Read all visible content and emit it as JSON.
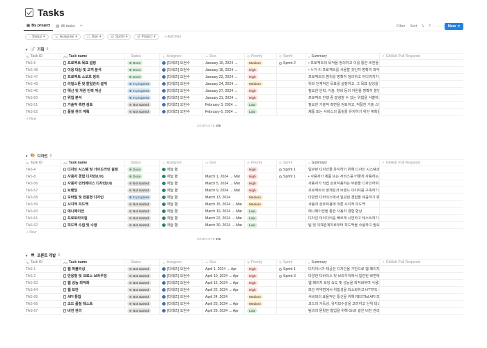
{
  "page": {
    "title": "Tasks"
  },
  "views": [
    {
      "label": "By project",
      "active": true
    },
    {
      "label": "All tasks",
      "active": false
    }
  ],
  "toolbar": {
    "filter": "Filter",
    "sort": "Sort",
    "new_label": "New"
  },
  "filters": [
    "Status",
    "Assignee",
    "Due",
    "Sprint",
    "Project"
  ],
  "add_filter": "+ Add filter",
  "columns": {
    "id": "Task ID",
    "name": "Task name",
    "status": "Status",
    "assignee": "Assignee",
    "due": "Due",
    "priority": "Priority",
    "sprint": "Sprint",
    "summary": "Summary",
    "gh": "GitHub Pull Requests"
  },
  "new_row": "+ New",
  "complete_label": "COMPLETE",
  "groups": [
    {
      "name": "기획",
      "count": "8",
      "icon": "notepad-emoji",
      "complete": "3/8",
      "rows": [
        {
          "id": "TAS-5",
          "name": "프로젝트 목표 설정",
          "status": "Done",
          "assignee": "[디테즈] 오현수",
          "due": "January 10, 2024 →",
          "priority": "Medium",
          "sprint": "Sprint 2",
          "summary": "• 프로젝트의 목적을 정의하고 이를 통한 비전을 설명합"
        },
        {
          "id": "TAS-48",
          "name": "이용 대상 및 고객 분석",
          "status": "Done",
          "assignee": "[디테즈] 오현수",
          "due": "January 15, 2024 →",
          "priority": "High",
          "sprint": "",
          "summary": "• 누가 이 프로젝트를 사용할 것인지 명확히 파악하고 대"
        },
        {
          "id": "TAS-47",
          "name": "프로젝트 스코프 정의",
          "status": "Done",
          "assignee": "[디테즈] 오현수",
          "due": "January 22, 2024 →",
          "priority": "High",
          "sprint": "",
          "summary": "프로젝트의 범위를 명확히 정의하고 어디까지가 포함되는"
        },
        {
          "id": "TAS-49",
          "name": "리밀스톤 및 할일관리 설계",
          "status": "In progress",
          "assignee": "[디테즈] 오현수",
          "due": "January 24, 2024 →",
          "priority": "Medium",
          "sprint": "",
          "summary": "위와 단계적인 목표를 설정하고, 그 목표 달성을 위한 일"
        },
        {
          "id": "TAS-46",
          "name": "예산 및 자원 인력 계산",
          "status": "In progress",
          "assignee": "[디테즈] 오현수",
          "due": "January 27, 2024 →",
          "priority": "High",
          "sprint": "",
          "summary": "필요한 인력, 기술, 장비 등의 자원을 명확히 할당하고, 이"
        },
        {
          "id": "TAS-50",
          "name": "위험 분석",
          "status": "In progress",
          "assignee": "[디테즈] 오현수",
          "due": "January 31, 2024 →",
          "priority": "High",
          "sprint": "",
          "summary": "프로젝트 진행 중 발생할 수 있는 위험을 식별하고, 그에"
        },
        {
          "id": "TAS-51",
          "name": "기술적 측면 검토",
          "status": "Not started",
          "assignee": "[디테즈] 오현수",
          "due": "February 3, 2024 →",
          "priority": "Low",
          "sprint": "",
          "summary": "필요한 기술적 측면을 검토하고, 적절한 기술 스택 및 도"
        },
        {
          "id": "TAS-52",
          "name": "품질 관리 계획",
          "status": "Not started",
          "assignee": "[디테즈] 오현수",
          "due": "February 6, 2024 →",
          "priority": "Low",
          "sprint": "",
          "summary": "제품 또는 서비스의 품질을 유지하기 위한 계획을 수립하"
        }
      ]
    },
    {
      "name": "디자인",
      "count": "8",
      "icon": "palette-emoji",
      "complete": "2/9",
      "rows": [
        {
          "id": "TAS-4",
          "name": "디자인 시스템 및 가이드라인 설정",
          "status": "Done",
          "assignee": "하늘 황",
          "due": "",
          "priority": "High",
          "sprint": "Sprint 1",
          "summary": "일관된 디자인을 유지하기 위해 디자인 시스템과 스타일"
        },
        {
          "id": "TAS-8",
          "name": "사용자 경험 디자인(UX)",
          "status": "Done",
          "assignee": "하늘 황",
          "due": "March 1, 2024 → Mar",
          "priority": "High",
          "sprint": "Sprint 1",
          "summary": "• 사용자가 제품 또는 서비스를 어떻게 사용하는지 분석"
        },
        {
          "id": "TAS-56",
          "name": "사용자 인터페이스 디자인(UI)",
          "status": "Not started",
          "assignee": "하늘 황",
          "due": "March 5, 2024 → Mar",
          "priority": "High",
          "sprint": "",
          "summary": "사용자가 직접 상호작용하는 부분을 디자인하며 시각적인"
        },
        {
          "id": "TAS-57",
          "name": "브랜딩",
          "status": "Not started",
          "assignee": "하늘 황",
          "due": "March 9, 2024 → Mar",
          "priority": "High",
          "sprint": "",
          "summary": "프로젝트의 정체성과 브랜드 이미지를 구축하기 위한 로"
        },
        {
          "id": "TAS-58",
          "name": "모바일 및 반응형 디자인",
          "status": "In progress",
          "assignee": "하늘 황",
          "due": "March 13, 2024",
          "priority": "Medium",
          "sprint": "",
          "summary": "다양한 디바이스에서 일관된 경험을 제공하기 위해 모바일"
        },
        {
          "id": "TAS-59",
          "name": "시각적 피드백",
          "status": "Not started",
          "assignee": "하늘 황",
          "due": "March 15, 2024 → Mar",
          "priority": "Medium",
          "sprint": "",
          "summary": "사용자 상호작용에 따른 시각적 피드백"
        },
        {
          "id": "TAS-60",
          "name": "애니메이션",
          "status": "Not started",
          "assignee": "하늘 황",
          "due": "March 19, 2024 → Mar",
          "priority": "Low",
          "sprint": "",
          "summary": "애니메이션을 통한 사용자 경험 향상"
        },
        {
          "id": "TAS-61",
          "name": "프로토타이핑",
          "status": "Not started",
          "assignee": "하늘 황",
          "due": "March 22, 2024 → Mar",
          "priority": "Low",
          "sprint": "",
          "summary": "디자인 아이디어를 빠르게 시연하고 테스트하기 위한 프"
        },
        {
          "id": "TAS-62",
          "name": "피드백 수집 및 수정",
          "status": "Not started",
          "assignee": "하늘 황",
          "due": "March 30, 2024 → Mar",
          "priority": "Low",
          "sprint": "",
          "summary": "팀 및 이해관계자로부터 피드백을 수용하고 필요한 경우"
        }
      ]
    },
    {
      "name": "프론트 개발",
      "count": "8",
      "icon": "computer-emoji",
      "complete": "",
      "rows": [
        {
          "id": "TAS-1",
          "name": "웹 퍼블리싱",
          "status": "Not started",
          "assignee": "[디테즈] 오현수",
          "due": "April 1, 2024 → Apr",
          "priority": "High",
          "sprint": "Sprint 1",
          "summary": "디자이너가 제공한 디자인을 기반으로 웹 페이지 또는 애"
        },
        {
          "id": "TAS-2",
          "name": "반응형 및 크로스 브라우징",
          "status": "Not started",
          "assignee": "[디테즈] 오현수",
          "due": "April 10, 2024 → Apr",
          "priority": "High",
          "sprint": "Sprint 3",
          "summary": "다양한 디바이스 및 브라우저에서 일관된 화면에서 동시"
        },
        {
          "id": "TAS-63",
          "name": "웹 성능 최적화",
          "status": "Not started",
          "assignee": "[디테즈] 오현수",
          "due": "April 16, 2024 → Apr",
          "priority": "High",
          "sprint": "",
          "summary": "웹 페이지 로딩 속도 및 성능을 최적화하여 사용자 경험을"
        },
        {
          "id": "TAS-64",
          "name": "웹 보안",
          "status": "Not started",
          "assignee": "[디테즈] 오현수",
          "due": "April 22, 2024 → Apr",
          "priority": "High",
          "sprint": "",
          "summary": "보안 취약점에서 위험성을 최소화하고 HTTPS 사용, 입"
        },
        {
          "id": "TAS-65",
          "name": "API 통합",
          "status": "Not started",
          "assignee": "[디테즈] 오현수",
          "due": "April 24, 2024",
          "priority": "Medium",
          "sprint": "",
          "summary": "서버와의 효율적인 통신을 위해 RESTful API 또는 Gra"
        },
        {
          "id": "TAS-66",
          "name": "코드 품질 테스트",
          "status": "Not started",
          "assignee": "[디테즈] 오현수",
          "due": "April 25, 2024 → Apr",
          "priority": "Medium",
          "sprint": "",
          "summary": "코드의 가독성, 유지보수성을 고려하고 단위 테스트 및 통"
        },
        {
          "id": "TAS-67",
          "name": "버전 관리",
          "status": "Not started",
          "assignee": "[디테즈] 오현수",
          "due": "April 29, 2024 → Apr",
          "priority": "Low",
          "sprint": "",
          "summary": "팀과의 원활한 협업을 위해 Git과 같은 버전 관리 도구를"
        }
      ]
    }
  ]
}
